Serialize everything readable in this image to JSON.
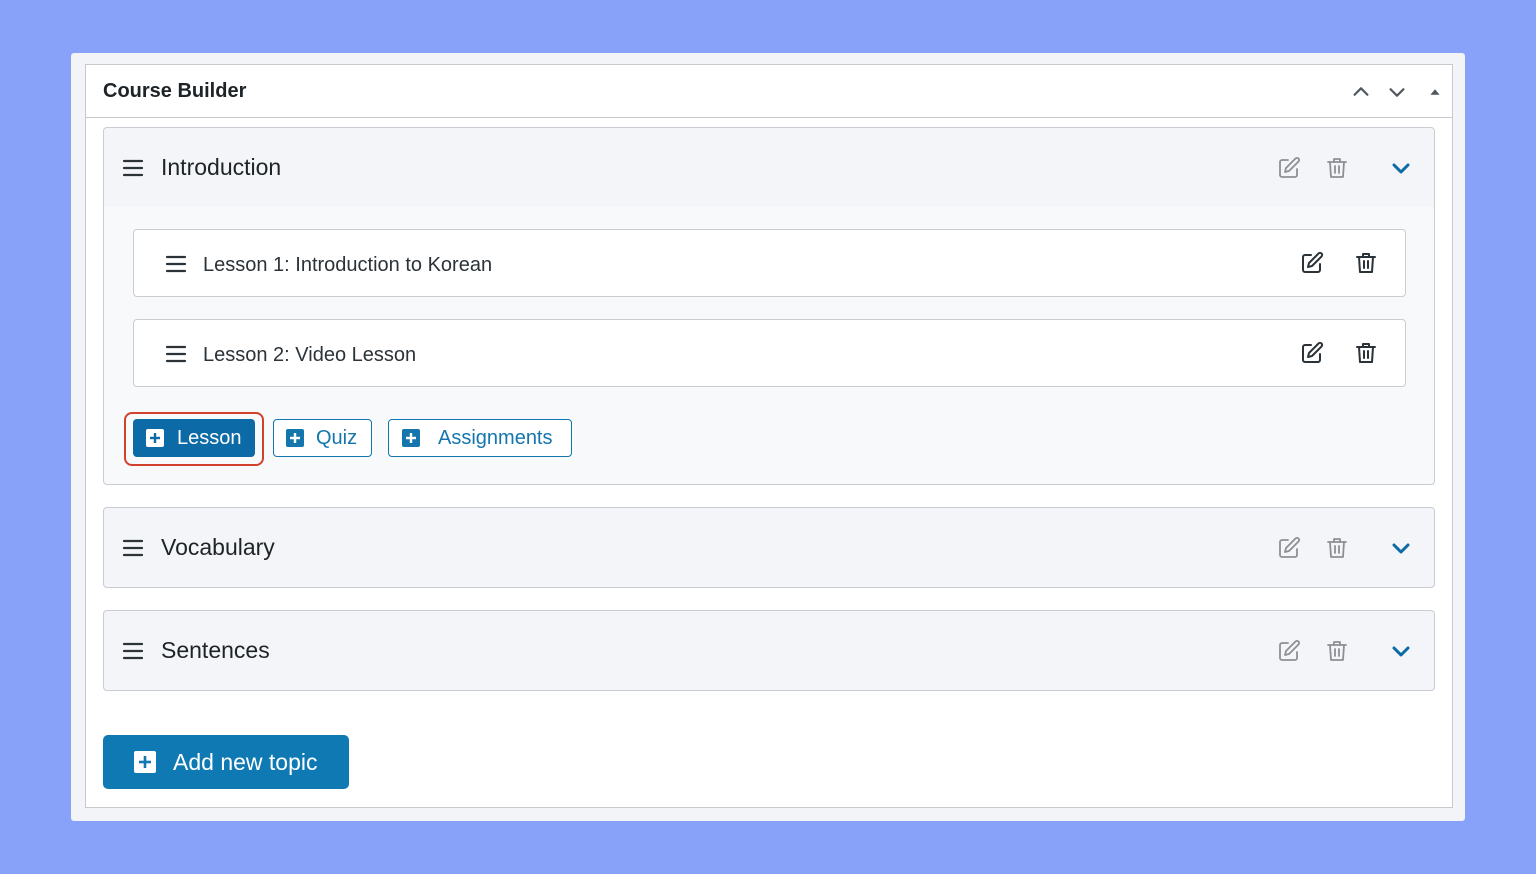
{
  "panel": {
    "title": "Course Builder"
  },
  "topics": [
    {
      "title": "Introduction",
      "expanded": true,
      "lessons": [
        {
          "title": "Lesson 1: Introduction to Korean"
        },
        {
          "title": "Lesson 2: Video Lesson"
        }
      ],
      "actions": {
        "lesson_label": "Lesson",
        "quiz_label": "Quiz",
        "assignments_label": "Assignments"
      }
    },
    {
      "title": "Vocabulary",
      "expanded": false
    },
    {
      "title": "Sentences",
      "expanded": false
    }
  ],
  "footer": {
    "add_topic_label": "Add new topic"
  },
  "icons": {
    "drag": "hamburger-drag-icon",
    "edit": "pencil-square-icon",
    "delete": "trash-icon",
    "expand": "chevron-down-icon",
    "add": "plus-square-icon",
    "move_up": "chevron-up-icon",
    "move_down": "chevron-down-icon",
    "collapse": "triangle-up-icon"
  },
  "colors": {
    "background": "#87a2f8",
    "primary": "#0c6aa6",
    "accent_blue": "#1476ad",
    "highlight": "#d2412b"
  }
}
